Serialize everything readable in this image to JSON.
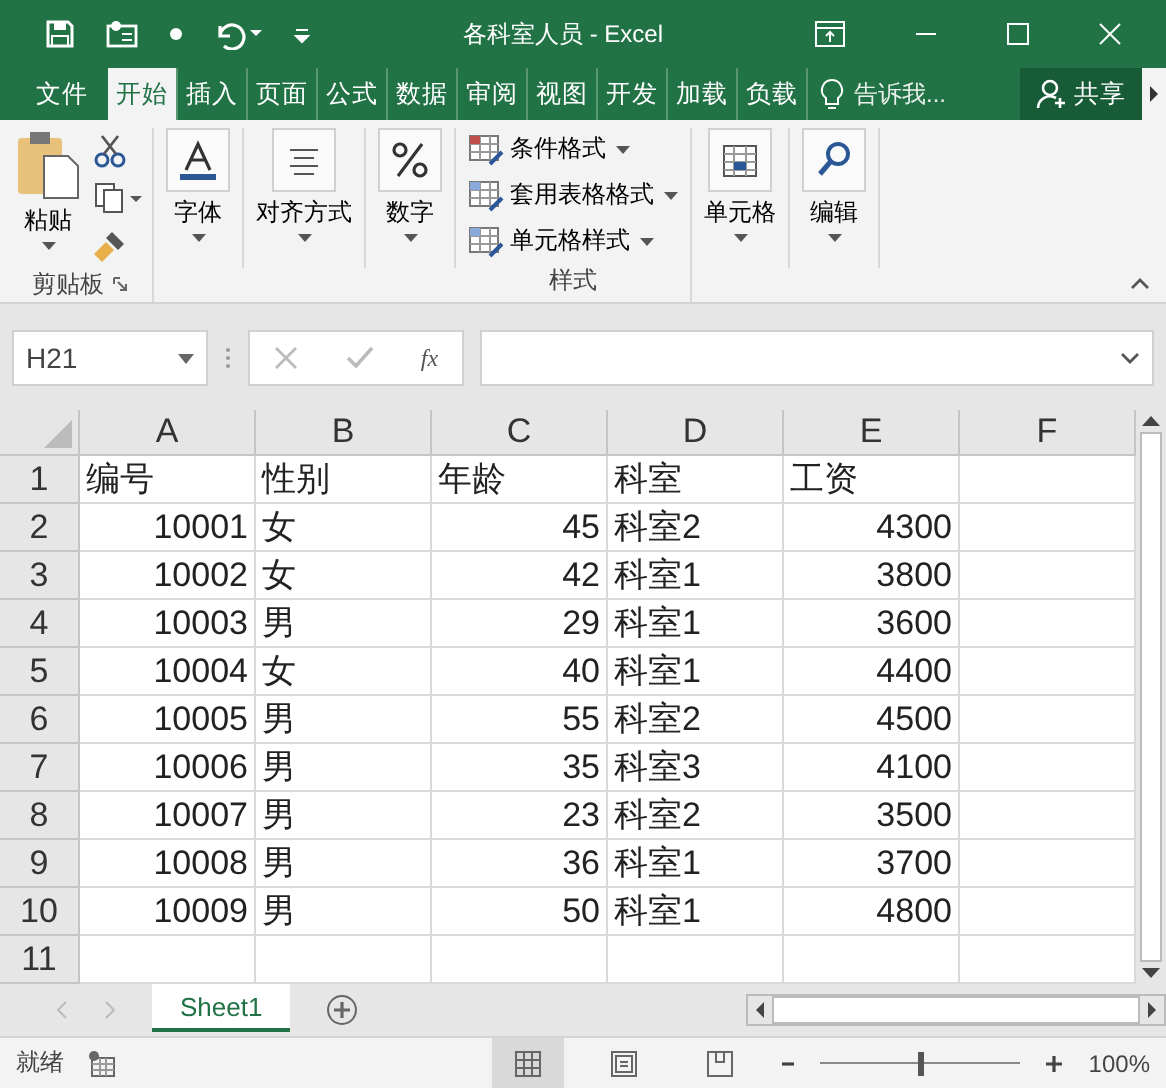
{
  "window": {
    "title": "各科室人员 - Excel"
  },
  "menu_tabs": [
    {
      "label": "文件",
      "selected": false
    },
    {
      "label": "开始",
      "selected": true
    },
    {
      "label": "插入",
      "selected": false
    },
    {
      "label": "页面",
      "selected": false
    },
    {
      "label": "公式",
      "selected": false
    },
    {
      "label": "数据",
      "selected": false
    },
    {
      "label": "审阅",
      "selected": false
    },
    {
      "label": "视图",
      "selected": false
    },
    {
      "label": "开发",
      "selected": false
    },
    {
      "label": "加载",
      "selected": false
    },
    {
      "label": "负载",
      "selected": false
    }
  ],
  "tell_me": {
    "placeholder": "告诉我..."
  },
  "share": "共享",
  "ribbon": {
    "clipboard": {
      "paste": "粘贴",
      "label": "剪贴板"
    },
    "big_buttons": [
      {
        "label": "字体",
        "kind": "font"
      },
      {
        "label": "对齐方式",
        "kind": "align"
      },
      {
        "label": "数字",
        "kind": "number"
      }
    ],
    "styles": {
      "items": [
        "条件格式",
        "套用表格格式",
        "单元格样式"
      ],
      "label": "样式"
    },
    "big_buttons_2": [
      {
        "label": "单元格",
        "kind": "cells"
      },
      {
        "label": "编辑",
        "kind": "edit"
      }
    ]
  },
  "formula_bar": {
    "name_box": "H21",
    "fx": "fx"
  },
  "sheet": {
    "columns": [
      "A",
      "B",
      "C",
      "D",
      "E",
      "F"
    ],
    "rows": [
      {
        "num": "1",
        "cells": [
          "编号",
          "性别",
          "年龄",
          "科室",
          "工资"
        ]
      },
      {
        "num": "2",
        "cells": [
          "10001",
          "女",
          "45",
          "科室2",
          "4300"
        ]
      },
      {
        "num": "3",
        "cells": [
          "10002",
          "女",
          "42",
          "科室1",
          "3800"
        ]
      },
      {
        "num": "4",
        "cells": [
          "10003",
          "男",
          "29",
          "科室1",
          "3600"
        ]
      },
      {
        "num": "5",
        "cells": [
          "10004",
          "女",
          "40",
          "科室1",
          "4400"
        ]
      },
      {
        "num": "6",
        "cells": [
          "10005",
          "男",
          "55",
          "科室2",
          "4500"
        ]
      },
      {
        "num": "7",
        "cells": [
          "10006",
          "男",
          "35",
          "科室3",
          "4100"
        ]
      },
      {
        "num": "8",
        "cells": [
          "10007",
          "男",
          "23",
          "科室2",
          "3500"
        ]
      },
      {
        "num": "9",
        "cells": [
          "10008",
          "男",
          "36",
          "科室1",
          "3700"
        ]
      },
      {
        "num": "10",
        "cells": [
          "10009",
          "男",
          "50",
          "科室1",
          "4800"
        ]
      },
      {
        "num": "11",
        "cells": []
      }
    ]
  },
  "sheet_tabs": [
    {
      "label": "Sheet1",
      "selected": true
    }
  ],
  "status_bar": {
    "text": "就绪",
    "zoom": {
      "level": 0.5,
      "reading": "100%"
    }
  }
}
